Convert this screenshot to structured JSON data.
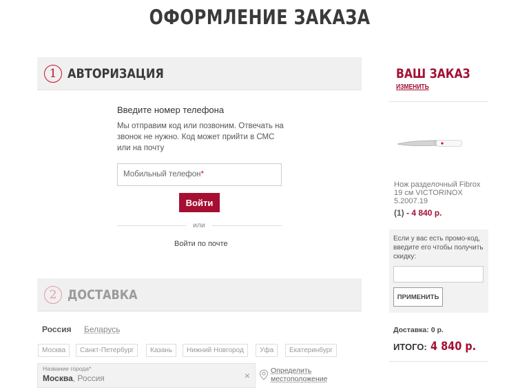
{
  "page_title": "ОФОРМЛЕНИЕ ЗАКАЗА",
  "auth": {
    "number": "1",
    "title": "АВТОРИЗАЦИЯ",
    "heading": "Введите номер телефона",
    "description": "Мы отправим код или позвоним. Отвечать на звонок не нужно. Код может прийти в СМС или на почту",
    "phone_placeholder": "Мобильный телефон",
    "required_mark": "*",
    "login_button": "Войти",
    "or_text": "или",
    "email_login": "Войти по почте"
  },
  "delivery": {
    "number": "2",
    "title": "ДОСТАВКА",
    "countries": [
      "Россия",
      "Беларусь"
    ],
    "cities": [
      "Москва",
      "Санкт-Петербург",
      "Казань",
      "Нижний Новгород",
      "Уфа",
      "Екатеринбург"
    ],
    "city_label": "Название города*",
    "city_value": "Москва",
    "city_region": ", Россия",
    "clear_symbol": "×",
    "geo_line1": "Определить",
    "geo_line2": "местоположение"
  },
  "order": {
    "title": "ВАШ ЗАКАЗ",
    "edit": "ИЗМЕНИТЬ",
    "product_name": "Нож разделочный Fibrox 19 см VICTORINOX 5.2007.19",
    "quantity": "(1)",
    "price": " - 4 840 р.",
    "promo_text": "Если у вас есть промо-код, введите его чтобы получить скидку:",
    "promo_button": "ПРИМЕНИТЬ",
    "delivery_label": "Доставка:",
    "delivery_value": "0 р.",
    "total_label": "ИТОГО:",
    "total_value": "4 840 р."
  },
  "colors": {
    "accent": "#a50f32",
    "step_active": "#c8102e",
    "step_inactive": "#e59aa8"
  },
  "icons": {
    "location": "location-pin-icon",
    "clear": "clear-icon"
  }
}
